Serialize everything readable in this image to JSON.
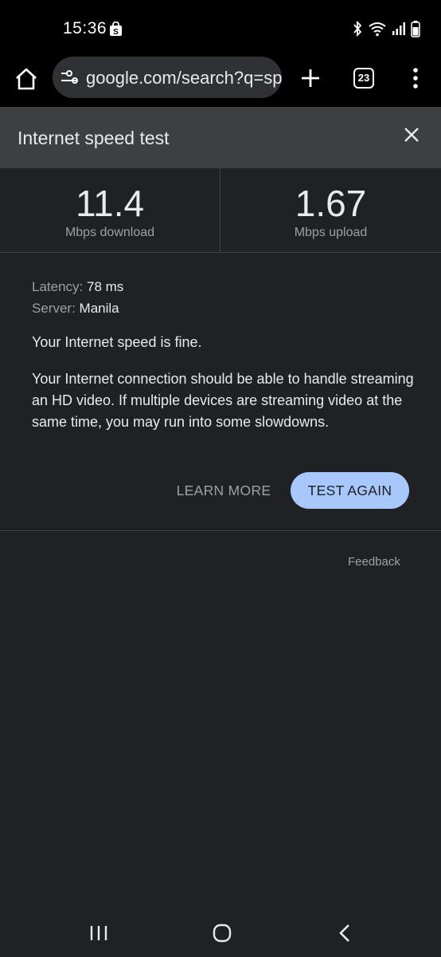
{
  "status": {
    "time": "15:36",
    "icons": [
      "shopping-bag-icon",
      "bluetooth-icon",
      "wifi-icon",
      "signal-icon",
      "battery-icon"
    ]
  },
  "browser": {
    "url": "google.com/search?q=sp",
    "tab_count": "23",
    "icons": [
      "home-icon",
      "tune-icon",
      "plus-icon",
      "more-vert-icon"
    ]
  },
  "panel": {
    "title": "Internet speed test",
    "download": {
      "value": "11.4",
      "label": "Mbps download"
    },
    "upload": {
      "value": "1.67",
      "label": "Mbps upload"
    },
    "latency_label": "Latency:",
    "latency_value": "78 ms",
    "server_label": "Server:",
    "server_value": "Manila",
    "summary": "Your Internet speed is fine.",
    "explanation": "Your Internet connection should be able to handle streaming an HD video. If multiple devices are streaming video at the same time, you may run into some slowdowns.",
    "learn_more": "LEARN MORE",
    "test_again": "TEST AGAIN",
    "feedback": "Feedback"
  },
  "colors": {
    "background": "#202124",
    "header": "#3c4043",
    "accent_button": "#a8c7fa"
  }
}
